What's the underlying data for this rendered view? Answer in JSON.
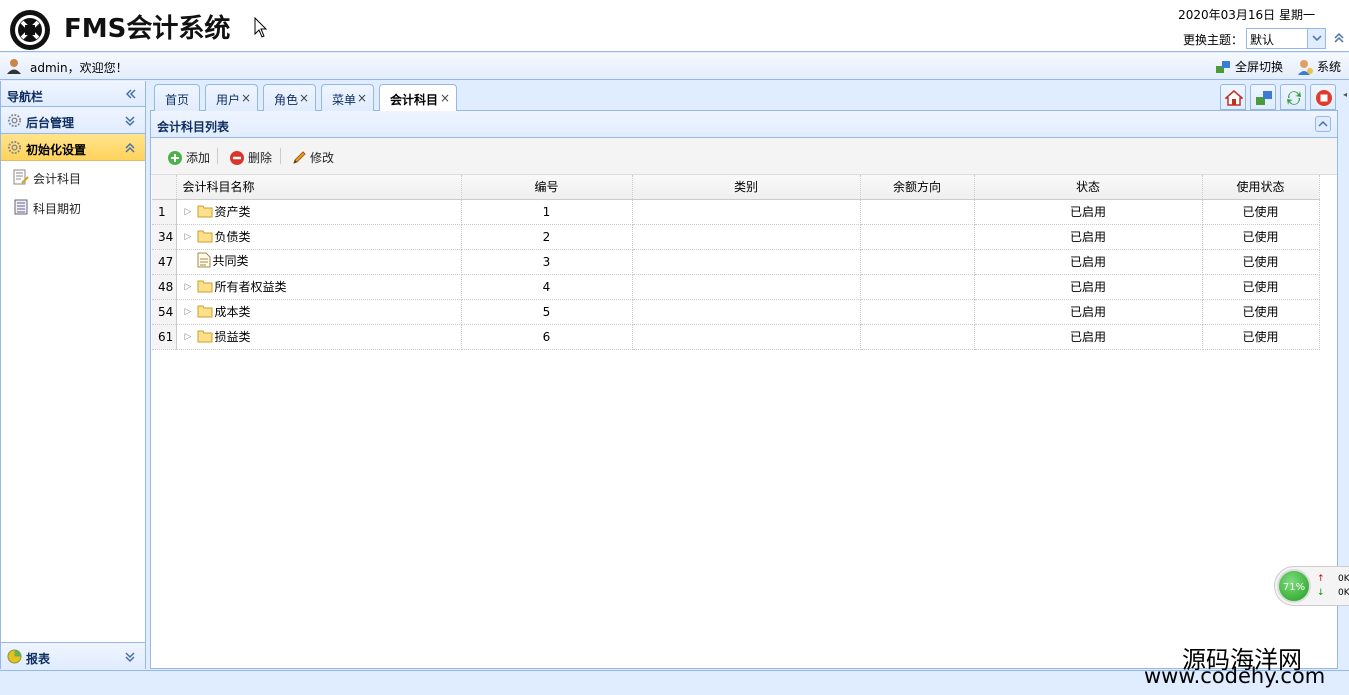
{
  "header": {
    "title": "FMS会计系统",
    "date": "2020年03月16日 星期一",
    "theme_label": "更换主题：",
    "theme_value": "默认"
  },
  "userbar": {
    "welcome": "admin，欢迎您！",
    "fullscreen": "全屏切换",
    "system": "系统"
  },
  "nav": {
    "title": "导航栏",
    "groups": [
      {
        "label": "后台管理"
      },
      {
        "label": "初始化设置",
        "items": [
          {
            "label": "会计科目"
          },
          {
            "label": "科目期初"
          }
        ]
      },
      {
        "label": "报表"
      }
    ]
  },
  "tabs": [
    {
      "label": "首页"
    },
    {
      "label": "用户"
    },
    {
      "label": "角色"
    },
    {
      "label": "菜单"
    },
    {
      "label": "会计科目"
    }
  ],
  "panel": {
    "title": "会计科目列表",
    "toolbar": {
      "add": "添加",
      "delete": "删除",
      "edit": "修改"
    }
  },
  "grid": {
    "columns": [
      "会计科目名称",
      "编号",
      "类别",
      "余额方向",
      "状态",
      "使用状态"
    ],
    "rows": [
      {
        "rn": "1",
        "name": "资产类",
        "code": "1",
        "category": "",
        "direction": "",
        "status": "已启用",
        "use": "已使用",
        "folder": true
      },
      {
        "rn": "34",
        "name": "负债类",
        "code": "2",
        "category": "",
        "direction": "",
        "status": "已启用",
        "use": "已使用",
        "folder": true
      },
      {
        "rn": "47",
        "name": "共同类",
        "code": "3",
        "category": "",
        "direction": "",
        "status": "已启用",
        "use": "已使用",
        "folder": false
      },
      {
        "rn": "48",
        "name": "所有者权益类",
        "code": "4",
        "category": "",
        "direction": "",
        "status": "已启用",
        "use": "已使用",
        "folder": true
      },
      {
        "rn": "54",
        "name": "成本类",
        "code": "5",
        "category": "",
        "direction": "",
        "status": "已启用",
        "use": "已使用",
        "folder": true
      },
      {
        "rn": "61",
        "name": "损益类",
        "code": "6",
        "category": "",
        "direction": "",
        "status": "已启用",
        "use": "已使用",
        "folder": true
      }
    ]
  },
  "speed": {
    "percent": "71%",
    "up": "0K",
    "down": "0K"
  },
  "watermark": {
    "line1": "源码海洋网",
    "line2": "www.codehy.com"
  }
}
